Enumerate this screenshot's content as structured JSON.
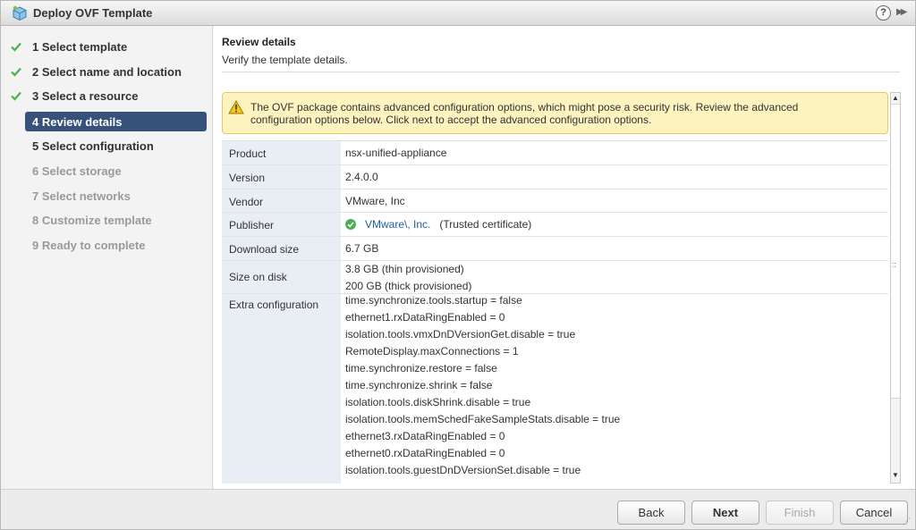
{
  "window": {
    "title": "Deploy OVF Template",
    "help_glyph": "?",
    "expand_glyph": "▶▶"
  },
  "steps": [
    {
      "label": "1  Select template",
      "state": "done"
    },
    {
      "label": "2  Select name and location",
      "state": "done"
    },
    {
      "label": "3  Select a resource",
      "state": "done"
    },
    {
      "label": "4  Review details",
      "state": "active"
    },
    {
      "label": "5  Select configuration",
      "state": "enabled"
    },
    {
      "label": "6  Select storage",
      "state": "disabled"
    },
    {
      "label": "7  Select networks",
      "state": "disabled"
    },
    {
      "label": "8  Customize template",
      "state": "disabled"
    },
    {
      "label": "9  Ready to complete",
      "state": "disabled"
    }
  ],
  "content": {
    "title": "Review details",
    "subtitle": "Verify the template details."
  },
  "warning": {
    "line1": "The OVF package contains advanced configuration options, which might pose a security risk. Review the advanced",
    "line2": "configuration options below. Click next to accept the advanced configuration options."
  },
  "details": {
    "product": {
      "key": "Product",
      "value": "nsx-unified-appliance"
    },
    "version": {
      "key": "Version",
      "value": "2.4.0.0"
    },
    "vendor": {
      "key": "Vendor",
      "value": "VMware, Inc"
    },
    "publisher": {
      "key": "Publisher",
      "name": "VMware\\, Inc.",
      "note": "(Trusted certificate)"
    },
    "download_size": {
      "key": "Download size",
      "value": "6.7 GB"
    },
    "size_on_disk": {
      "key": "Size on disk",
      "values": [
        "3.8 GB (thin provisioned)",
        "200 GB (thick provisioned)"
      ]
    },
    "extra_configuration": {
      "key": "Extra configuration",
      "values": [
        "time.synchronize.tools.startup  =  false",
        "ethernet1.rxDataRingEnabled  =  0",
        "isolation.tools.vmxDnDVersionGet.disable  =  true",
        "RemoteDisplay.maxConnections  =  1",
        "time.synchronize.restore  =  false",
        "time.synchronize.shrink  =  false",
        "isolation.tools.diskShrink.disable  =  true",
        "isolation.tools.memSchedFakeSampleStats.disable  =  true",
        "ethernet3.rxDataRingEnabled  =  0",
        "ethernet0.rxDataRingEnabled  =  0",
        "isolation.tools.guestDnDVersionSet.disable  =  true"
      ]
    }
  },
  "footer": {
    "back": "Back",
    "next": "Next",
    "finish": "Finish",
    "cancel": "Cancel"
  },
  "colors": {
    "active_step": "#36527a",
    "check": "#4caf50",
    "warning_bg": "#fdf3bf",
    "link": "#1b5d9c"
  }
}
